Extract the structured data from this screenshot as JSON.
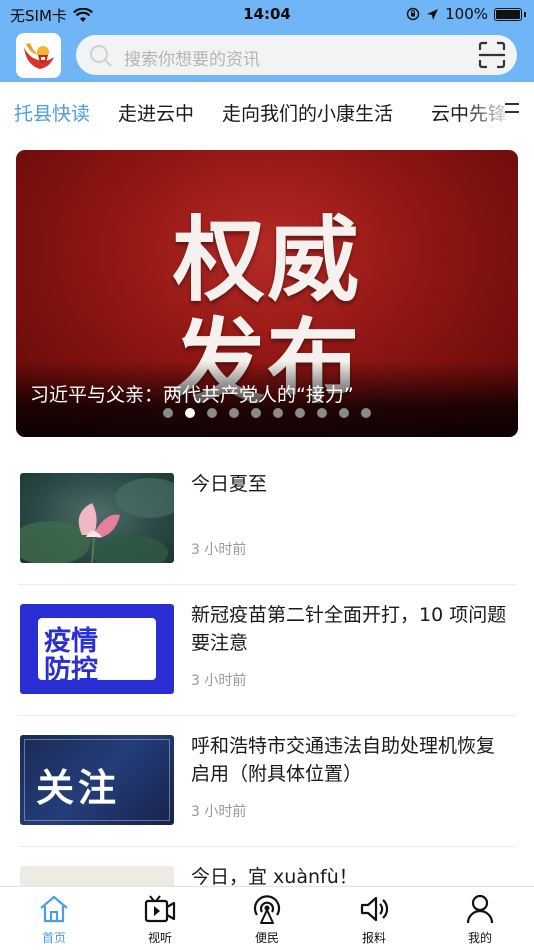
{
  "status_bar": {
    "carrier": "无SIM卡",
    "time": "14:04",
    "battery": "100%"
  },
  "search": {
    "placeholder": "搜索你想要的资讯"
  },
  "channels": [
    {
      "label": "托县快读",
      "active": true
    },
    {
      "label": "走进云中",
      "active": false
    },
    {
      "label": "走向我们的小康生活",
      "active": false
    },
    {
      "label": "云中先锋",
      "active": false
    }
  ],
  "banner": {
    "image_text_line1": "权威",
    "image_text_line2": "发布",
    "caption": "习近平与父亲：两代共产党人的“接力”",
    "slide_count": 10,
    "active_slide": 2
  },
  "news": [
    {
      "title": "今日夏至",
      "time": "3 小时前",
      "thumb": "lotus-image"
    },
    {
      "title": "新冠疫苗第二针全面开打，10 项问题要注意",
      "time": "3 小时前",
      "thumb": "epidemic-control-image",
      "thumb_text_1": "疫情",
      "thumb_text_2": "防控"
    },
    {
      "title": "呼和浩特市交通违法自助处理机恢复启用（附具体位置）",
      "time": "3 小时前",
      "thumb": "attention-image",
      "thumb_text": "关注"
    },
    {
      "title": "今日，宜 xuànfù！",
      "time": "",
      "thumb": "note-image"
    }
  ],
  "tabbar": [
    {
      "label": "首页",
      "icon": "home-icon",
      "active": true
    },
    {
      "label": "视听",
      "icon": "video-icon",
      "active": false
    },
    {
      "label": "便民",
      "icon": "broadcast-icon",
      "active": false
    },
    {
      "label": "报料",
      "icon": "speaker-icon",
      "active": false
    },
    {
      "label": "我的",
      "icon": "person-icon",
      "active": false
    }
  ],
  "colors": {
    "header_bg": "#70b6f6",
    "accent": "#4a9de8"
  }
}
